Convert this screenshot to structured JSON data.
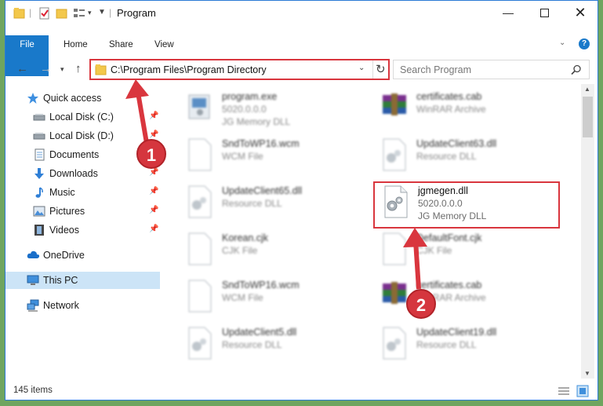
{
  "window": {
    "title": "Program",
    "minimize_icon": "minimize-icon",
    "maximize_icon": "maximize-icon",
    "close_icon": "close-icon"
  },
  "ribbon": {
    "tabs": [
      "File",
      "Home",
      "Share",
      "View"
    ],
    "help_icon": "help-icon"
  },
  "address": {
    "path": "C:\\Program Files\\Program Directory",
    "refresh_icon": "refresh-icon"
  },
  "search": {
    "placeholder": "Search Program"
  },
  "sidebar": {
    "items": [
      {
        "label": "Quick access",
        "icon": "star-icon",
        "pinned": false
      },
      {
        "label": "Local Disk (C:)",
        "icon": "drive-icon",
        "pinned": true
      },
      {
        "label": "Local Disk (D:)",
        "icon": "drive-icon",
        "pinned": true
      },
      {
        "label": "Documents",
        "icon": "documents-icon",
        "pinned": true
      },
      {
        "label": "Downloads",
        "icon": "download-icon",
        "pinned": true
      },
      {
        "label": "Music",
        "icon": "music-icon",
        "pinned": true
      },
      {
        "label": "Pictures",
        "icon": "pictures-icon",
        "pinned": true
      },
      {
        "label": "Videos",
        "icon": "videos-icon",
        "pinned": true
      },
      {
        "label": "OneDrive",
        "icon": "cloud-icon",
        "pinned": false
      },
      {
        "label": "This PC",
        "icon": "computer-icon",
        "pinned": false,
        "selected": true
      },
      {
        "label": "Network",
        "icon": "network-icon",
        "pinned": false
      }
    ]
  },
  "files": [
    {
      "name": "program.exe",
      "line2": "5020.0.0.0",
      "line3": "JG Memory DLL",
      "icon": "exe-icon"
    },
    {
      "name": "certificates.cab",
      "line2": "WinRAR Archive",
      "line3": "",
      "icon": "archive-icon"
    },
    {
      "name": "SndToWP16.wcm",
      "line2": "WCM File",
      "line3": "",
      "icon": "file-icon"
    },
    {
      "name": "UpdateClient63.dll",
      "line2": "Resource DLL",
      "line3": "",
      "icon": "dll-icon"
    },
    {
      "name": "UpdateClient65.dll",
      "line2": "Resource DLL",
      "line3": "",
      "icon": "dll-icon"
    },
    {
      "name": "jgmegen.dll",
      "line2": "5020.0.0.0",
      "line3": "JG Memory DLL",
      "icon": "dll-icon",
      "highlighted": true
    },
    {
      "name": "Korean.cjk",
      "line2": "CJK File",
      "line3": "",
      "icon": "file-icon"
    },
    {
      "name": "DefaultFont.cjk",
      "line2": "CJK File",
      "line3": "",
      "icon": "file-icon"
    },
    {
      "name": "SndToWP16.wcm",
      "line2": "WCM File",
      "line3": "",
      "icon": "file-icon"
    },
    {
      "name": "certificates.cab",
      "line2": "WinRAR Archive",
      "line3": "",
      "icon": "archive-icon"
    },
    {
      "name": "UpdateClient5.dll",
      "line2": "Resource DLL",
      "line3": "",
      "icon": "dll-icon"
    },
    {
      "name": "UpdateClient19.dll",
      "line2": "Resource DLL",
      "line3": "",
      "icon": "dll-icon"
    }
  ],
  "status": {
    "item_count": "145 items"
  },
  "callouts": {
    "step1": "1",
    "step2": "2",
    "color": "#d9363e"
  }
}
